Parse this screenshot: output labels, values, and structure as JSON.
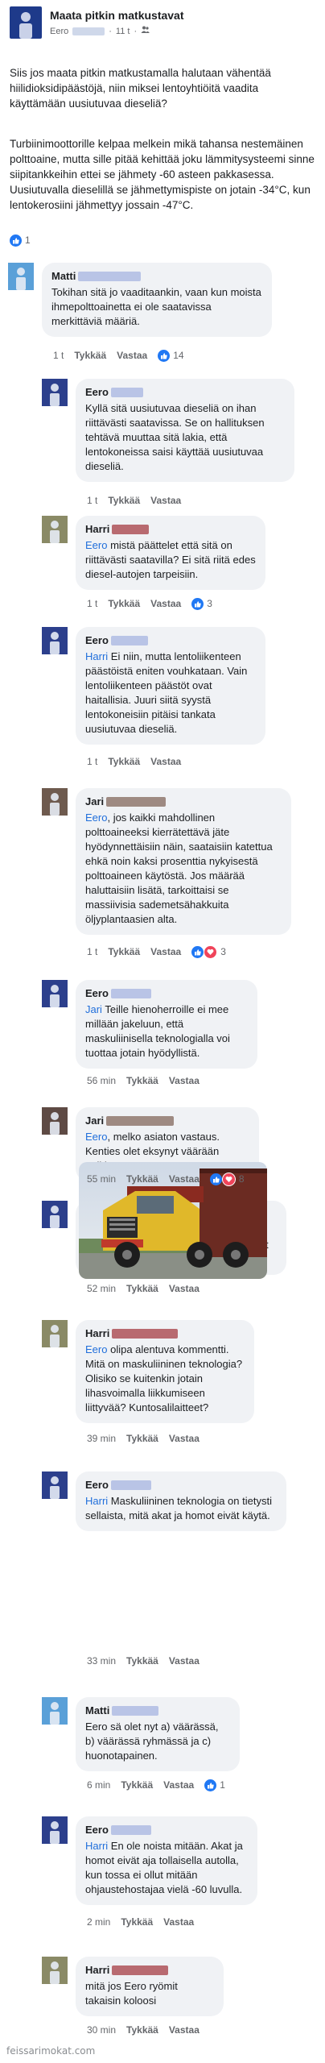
{
  "post": {
    "title": "Maata pitkin matkustavat",
    "author": "Eero",
    "time": "11 t",
    "privacy_icon": "friends-icon",
    "paragraphs": [
      "Siis jos maata pitkin matkustamalla halutaan vähentää hiilidioksidipäästöjä, niin miksei lentoyhtiöitä vaadita käyttämään uusiutuvaa dieseliä?",
      "Turbiinimoottorille kelpaa melkein mikä tahansa nestemäinen polttoaine, mutta sille pitää kehittää joku lämmitysysteemi sinne siipitankkeihin ettei se jähmety -60 asteen pakkasessa. Uusiutuvalla dieselillä se jähmettymispiste on jotain -34°C, kun lentokerosiini jähmettyy jossain -47°C."
    ],
    "like_count": "1"
  },
  "labels": {
    "like": "Tykkää",
    "reply": "Vastaa"
  },
  "comments": [
    {
      "name": "Matti",
      "time": "1 t",
      "mention": "",
      "text": "Tokihan sitä jo vaaditaankin, vaan kun moista ihmepolttoainetta ei ole saatavissa merkittäviä määriä.",
      "reaction_count": "14"
    },
    {
      "name": "Eero",
      "time": "1 t",
      "mention": "",
      "text": "Kyllä sitä uusiutuvaa dieseliä on ihan riittävästi saatavissa. Se on hallituksen tehtävä muuttaa sitä lakia, että lentokoneissa saisi käyttää uusiutuvaa dieseliä.",
      "reaction_count": ""
    },
    {
      "name": "Harri",
      "time": "1 t",
      "mention": "Eero",
      "text": "mistä päättelet että sitä on riittävästi saatavilla? Ei sitä riitä edes diesel-autojen tarpeisiin.",
      "reaction_count": "3"
    },
    {
      "name": "Eero",
      "time": "1 t",
      "mention": "Harri",
      "text": "Ei niin, mutta lentoliikenteen päästöistä eniten vouhkataan. Vain lentoliikenteen päästöt ovat haitallisia. Juuri siitä syystä lentokoneisiin pitäisi tankata uusiutuvaa dieseliä.",
      "reaction_count": ""
    },
    {
      "name": "Jari",
      "time": "1 t",
      "mention": "Eero",
      "text": ", jos kaikki mahdollinen polttoaineeksi kierrätettävä jäte hyödynnettäisiin näin, saataisiin katettua ehkä noin kaksi prosenttia nykyisestä polttoaineen käytöstä. Jos määrää haluttaisiin lisätä, tarkoittaisi se massiivisia sademetsähakkuita öljyplantaasien alta.",
      "reaction_count": "3"
    },
    {
      "name": "Eero",
      "time": "56 min",
      "mention": "Jari",
      "text": "Teille hienoherroille ei mee millään jakeluun, että maskuliinisella teknologialla voi tuottaa jotain hyödyllistä.",
      "reaction_count": ""
    },
    {
      "name": "Jari",
      "time": "55 min",
      "mention": "Eero",
      "text": ", melko asiaton vastaus. Kenties olet eksynyt väärään paikkaan.",
      "reaction_count": "8"
    },
    {
      "name": "Eero",
      "time": "52 min",
      "mention": "Jari",
      "text": "Esimerkiksi hienoherrat eivät ymmärrä, miksi veläläiset pommikoneet on maalattu valkoisiksi.",
      "reaction_count": ""
    },
    {
      "name": "Harri",
      "time": "39 min",
      "mention": "Eero",
      "text": "olipa alentuva kommentti. Mitä on maskuliininen teknologia? Olisiko se kuitenkin jotain lihasvoimalla liikkumiseen liittyvää? Kuntosalilaitteet?",
      "reaction_count": ""
    },
    {
      "name": "Eero",
      "time": "33 min",
      "mention": "Harri",
      "text": "Maskuliininen teknologia on tietysti sellaista, mitä akat ja homot eivät käytä.",
      "reaction_count": ""
    },
    {
      "name": "Matti",
      "time": "6 min",
      "mention": "",
      "text": "Eero sä olet nyt a) väärässä, b) väärässä ryhmässä ja c) huonotapainen.",
      "reaction_count": "1"
    },
    {
      "name": "Eero",
      "time": "2 min",
      "mention": "Harri",
      "text": "En ole noista mitään. Akat ja homot eivät aja tollaisella autolla, kun tossa ei ollut mitään ohjaustehostajaa vielä -60 luvulla.",
      "reaction_count": ""
    },
    {
      "name": "Harri",
      "time": "30 min",
      "mention": "",
      "text": "mitä jos Eero ryömit takaisin koloosi",
      "reaction_count": ""
    }
  ],
  "colors": {
    "accent": "#2078f4",
    "heart": "#f0445a",
    "bubble": "#f0f2f5",
    "mention": "#216fdb"
  },
  "watermark": "feissarimokat.com"
}
